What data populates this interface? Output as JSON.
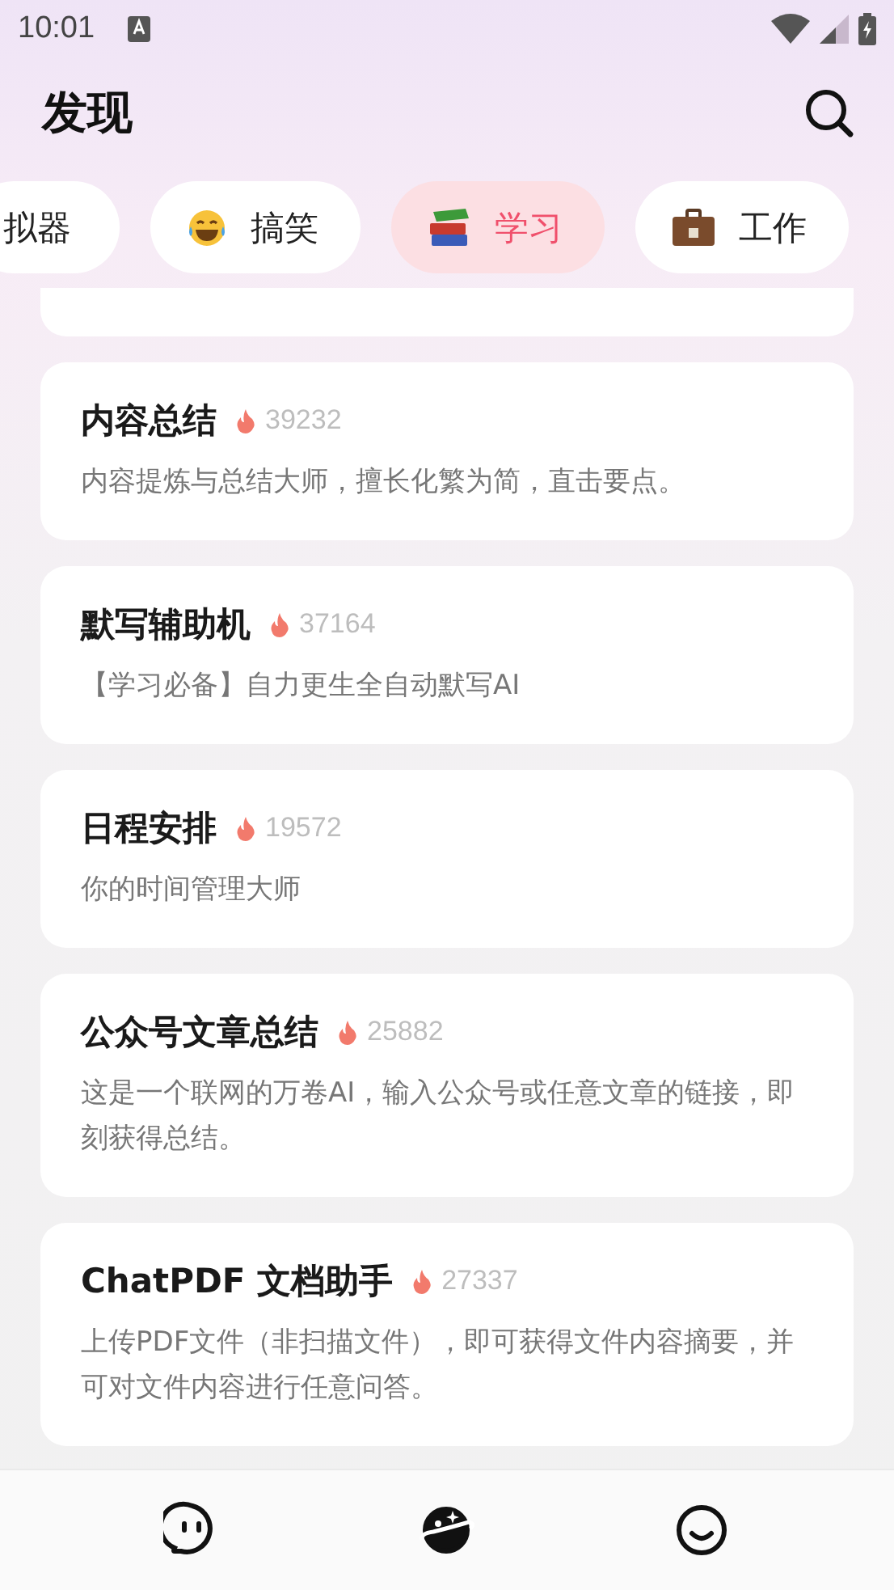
{
  "status_bar": {
    "time": "10:01"
  },
  "header": {
    "title": "发现"
  },
  "tabs": [
    {
      "label": "拟器",
      "selected": false
    },
    {
      "label": "搞笑",
      "selected": false
    },
    {
      "label": "学习",
      "selected": true
    },
    {
      "label": "工作",
      "selected": false
    }
  ],
  "cards": [
    {
      "title": "内容总结",
      "count": "39232",
      "description": "内容提炼与总结大师，擅长化繁为简，直击要点。"
    },
    {
      "title": "默写辅助机",
      "count": "37164",
      "description": "【学习必备】自力更生全自动默写AI"
    },
    {
      "title": "日程安排",
      "count": "19572",
      "description": "你的时间管理大师"
    },
    {
      "title": "公众号文章总结",
      "count": "25882",
      "description": "这是一个联网的万卷AI，输入公众号或任意文章的链接，即刻获得总结。"
    },
    {
      "title": "ChatPDF 文档助手",
      "count": "27337",
      "description": "上传PDF文件（非扫描文件），即可获得文件内容摘要，并可对文件内容进行任意问答。"
    }
  ],
  "bottom_nav": [
    {
      "selected": false
    },
    {
      "selected": true
    },
    {
      "selected": false
    }
  ]
}
